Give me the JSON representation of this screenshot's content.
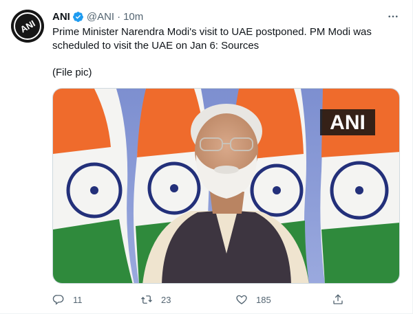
{
  "tweet": {
    "author_name": "ANI",
    "author_handle": "@ANI",
    "separator": "·",
    "time_ago": "10m",
    "text_line1": "Prime Minister Narendra Modi's visit to UAE postponed. PM Modi was",
    "text_line2": "scheduled to visit the UAE on Jan 6: Sources",
    "text_line3": "(File pic)",
    "media_watermark": "ANI",
    "avatar_logo_text": "ANI"
  },
  "actions": {
    "reply_count": "11",
    "retweet_count": "23",
    "like_count": "185"
  },
  "icons": {
    "more": "more-horizontal-icon",
    "verified": "verified-badge-icon",
    "reply": "reply-icon",
    "retweet": "retweet-icon",
    "like": "heart-icon",
    "share": "share-icon"
  },
  "colors": {
    "verified_blue": "#1d9bf0",
    "secondary_text": "#536471",
    "primary_text": "#0f1419"
  }
}
